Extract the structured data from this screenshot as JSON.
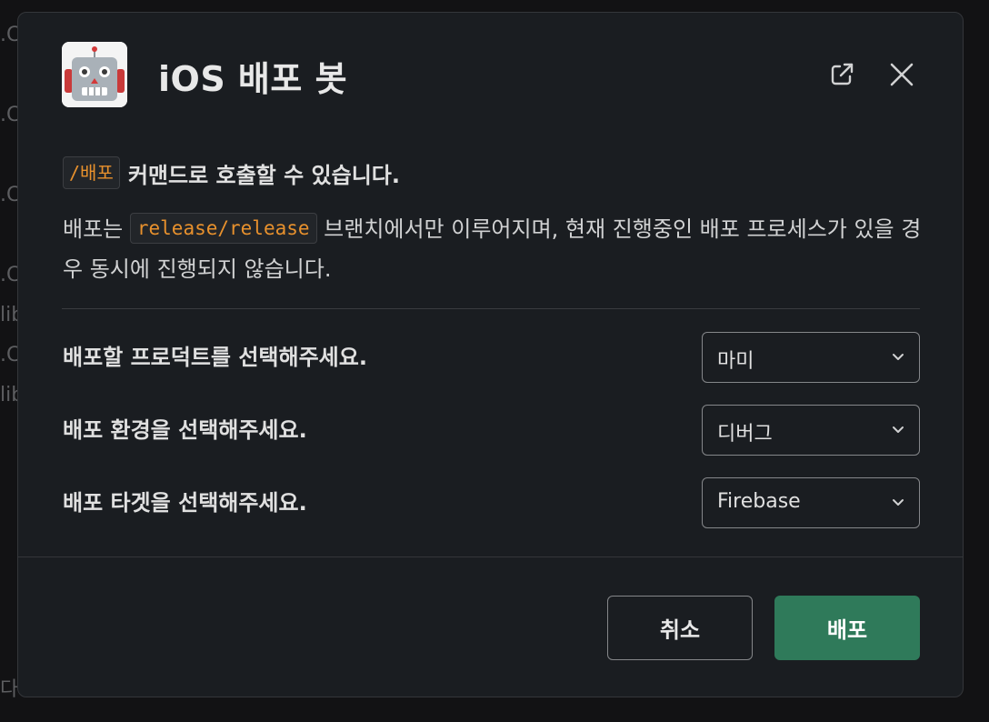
{
  "background": {
    "fragments": [
      ".C",
      ".C",
      ".C",
      ".C",
      "lib",
      ".C",
      "lib",
      "다"
    ]
  },
  "modal": {
    "app_icon": "robot-icon",
    "title": "iOS 배포 봇",
    "header_buttons": {
      "external": "external-link-icon",
      "close": "close-icon"
    },
    "command_tag": "/배포",
    "command_text": "커맨드로 호출할 수 있습니다.",
    "description": {
      "before": "배포는 ",
      "branch": "release/release",
      "after": " 브랜치에서만 이루어지며, 현재 진행중인 배포 프로세스가 있을 경우 동시에 진행되지 않습니다."
    },
    "fields": [
      {
        "label": "배포할 프로덕트를 선택해주세요.",
        "value": "마미"
      },
      {
        "label": "배포 환경을 선택해주세요.",
        "value": "디버그"
      },
      {
        "label": "배포 타겟을 선택해주세요.",
        "value": "Firebase"
      }
    ],
    "cancel_label": "취소",
    "submit_label": "배포"
  },
  "colors": {
    "background": "#121214",
    "modal": "#1a1d21",
    "code_text": "#e8912d",
    "primary_button": "#2f7a5a"
  }
}
